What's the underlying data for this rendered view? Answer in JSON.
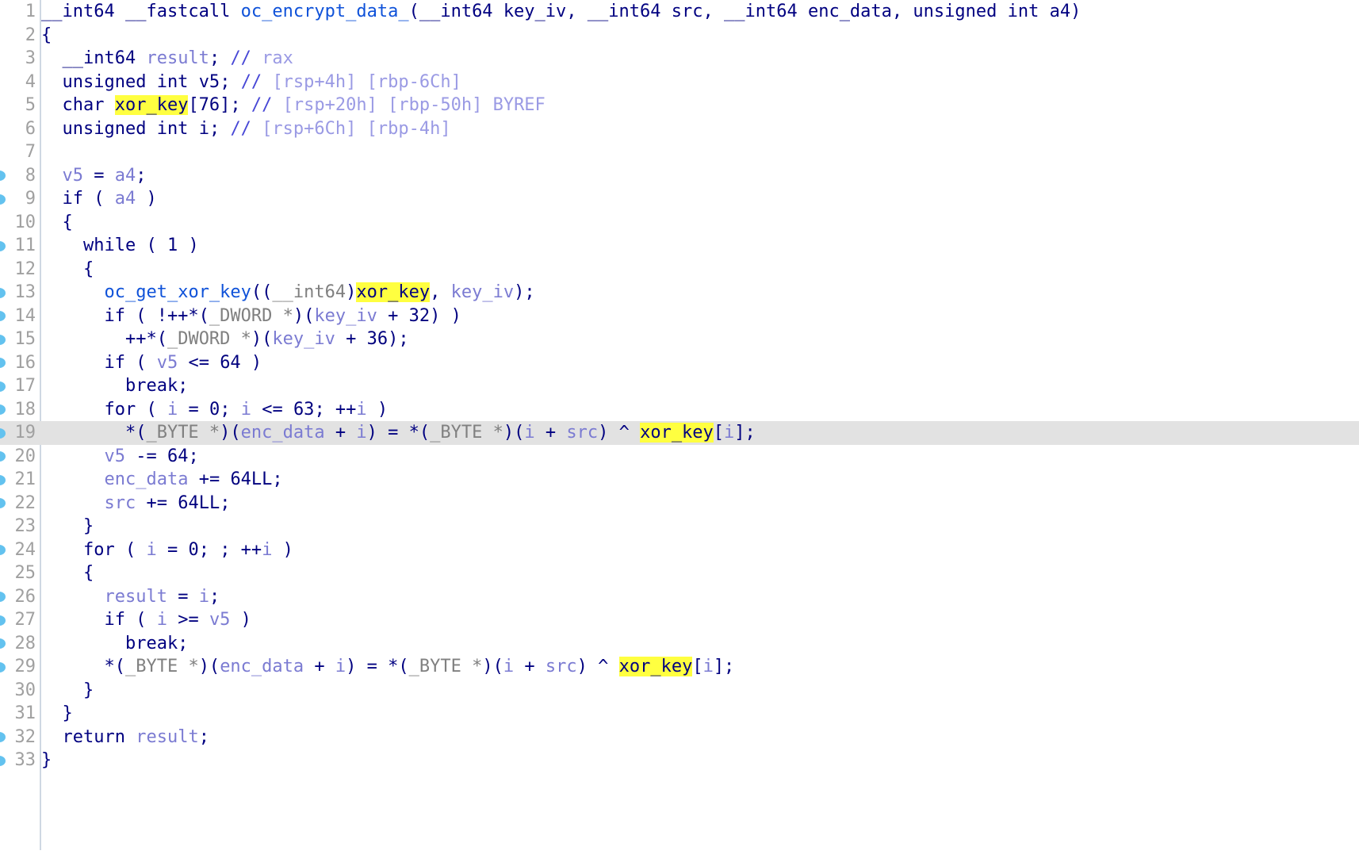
{
  "view": {
    "kind": "hex-rays-pseudocode",
    "function_name": "oc_encrypt_data_",
    "current_line": 19,
    "total_lines": 33,
    "colors": {
      "background": "#ffffff",
      "current_line_highlight": "#e2e2e2",
      "identifier_highlight": "#ffff40",
      "line_number": "#a0a0a0",
      "gutter_rule": "#cfd8e3",
      "address_dot": "#63c2ef",
      "keyword": "#000080",
      "function": "#0f52d9",
      "variable": "#7b7bd2",
      "comment": "#9a9ae4",
      "cast": "#808080"
    }
  },
  "lines": [
    {
      "n": "1",
      "dot": false,
      "text": "__int64 __fastcall oc_encrypt_data_(__int64 key_iv, __int64 src, __int64 enc_data, unsigned int a4)"
    },
    {
      "n": "2",
      "dot": false,
      "text": "{"
    },
    {
      "n": "3",
      "dot": false,
      "text": "  __int64 result; // rax"
    },
    {
      "n": "4",
      "dot": false,
      "text": "  unsigned int v5; // [rsp+4h] [rbp-6Ch]"
    },
    {
      "n": "5",
      "dot": false,
      "text": "  char xor_key[76]; // [rsp+20h] [rbp-50h] BYREF"
    },
    {
      "n": "6",
      "dot": false,
      "text": "  unsigned int i; // [rsp+6Ch] [rbp-4h]"
    },
    {
      "n": "7",
      "dot": false,
      "text": ""
    },
    {
      "n": "8",
      "dot": true,
      "text": "  v5 = a4;"
    },
    {
      "n": "9",
      "dot": true,
      "text": "  if ( a4 )"
    },
    {
      "n": "10",
      "dot": false,
      "text": "  {"
    },
    {
      "n": "11",
      "dot": true,
      "text": "    while ( 1 )"
    },
    {
      "n": "12",
      "dot": false,
      "text": "    {"
    },
    {
      "n": "13",
      "dot": true,
      "text": "      oc_get_xor_key((__int64)xor_key, key_iv);"
    },
    {
      "n": "14",
      "dot": true,
      "text": "      if ( !++*(_DWORD *)(key_iv + 32) )"
    },
    {
      "n": "15",
      "dot": true,
      "text": "        ++*(_DWORD *)(key_iv + 36);"
    },
    {
      "n": "16",
      "dot": true,
      "text": "      if ( v5 <= 64 )"
    },
    {
      "n": "17",
      "dot": true,
      "text": "        break;"
    },
    {
      "n": "18",
      "dot": true,
      "text": "      for ( i = 0; i <= 63; ++i )"
    },
    {
      "n": "19",
      "dot": true,
      "text": "        *(_BYTE *)(enc_data + i) = *(_BYTE *)(i + src) ^ xor_key[i];"
    },
    {
      "n": "20",
      "dot": true,
      "text": "      v5 -= 64;"
    },
    {
      "n": "21",
      "dot": true,
      "text": "      enc_data += 64LL;"
    },
    {
      "n": "22",
      "dot": true,
      "text": "      src += 64LL;"
    },
    {
      "n": "23",
      "dot": false,
      "text": "    }"
    },
    {
      "n": "24",
      "dot": true,
      "text": "    for ( i = 0; ; ++i )"
    },
    {
      "n": "25",
      "dot": false,
      "text": "    {"
    },
    {
      "n": "26",
      "dot": true,
      "text": "      result = i;"
    },
    {
      "n": "27",
      "dot": true,
      "text": "      if ( i >= v5 )"
    },
    {
      "n": "28",
      "dot": true,
      "text": "        break;"
    },
    {
      "n": "29",
      "dot": true,
      "text": "      *(_BYTE *)(enc_data + i) = *(_BYTE *)(i + src) ^ xor_key[i];"
    },
    {
      "n": "30",
      "dot": false,
      "text": "    }"
    },
    {
      "n": "31",
      "dot": false,
      "text": "  }"
    },
    {
      "n": "32",
      "dot": true,
      "text": "  return result;"
    },
    {
      "n": "33",
      "dot": true,
      "text": "}"
    }
  ],
  "highlighted_identifier": "xor_key",
  "symbols": {
    "function": "oc_encrypt_data_",
    "called_function": "oc_get_xor_key",
    "parameters": [
      "key_iv",
      "src",
      "enc_data",
      "a4"
    ],
    "locals": [
      "result",
      "v5",
      "xor_key",
      "i"
    ],
    "local_comments": {
      "result": "// rax",
      "v5": "// [rsp+4h] [rbp-6Ch]",
      "xor_key": "// [rsp+20h] [rbp-50h] BYREF",
      "i": "// [rsp+6Ch] [rbp-4h]"
    }
  }
}
